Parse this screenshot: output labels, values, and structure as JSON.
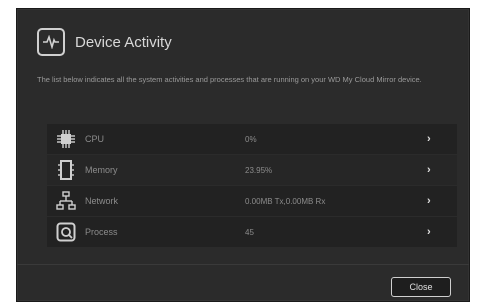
{
  "dialog": {
    "title": "Device Activity",
    "description": "The list below indicates all the system activities and processes that are running on your WD My Cloud Mirror device.",
    "close_label": "Close"
  },
  "rows": [
    {
      "label": "CPU",
      "value": "0%",
      "icon": "cpu-icon"
    },
    {
      "label": "Memory",
      "value": "23.95%",
      "icon": "memory-icon"
    },
    {
      "label": "Network",
      "value": "0.00MB Tx,0.00MB Rx",
      "icon": "network-icon"
    },
    {
      "label": "Process",
      "value": "45",
      "icon": "process-icon"
    }
  ],
  "colors": {
    "background": "#2b2b2b",
    "row": "#222222",
    "text": "#8c8c8c"
  }
}
